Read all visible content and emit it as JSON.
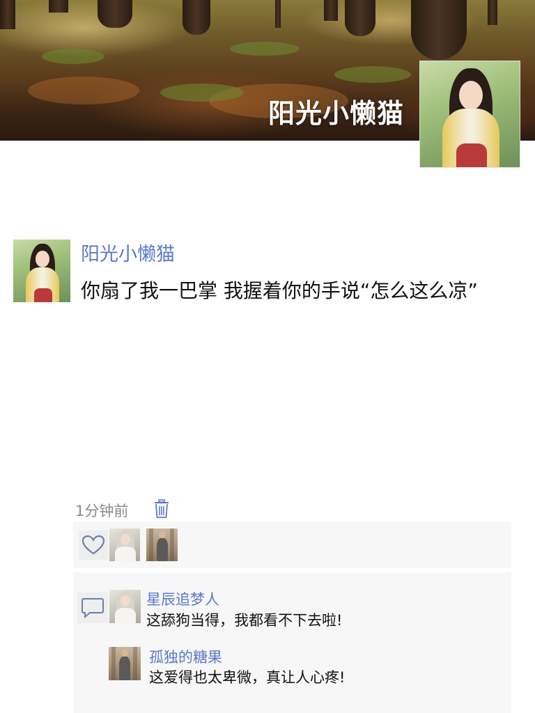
{
  "cover": {
    "title": "阳光小懒猫"
  },
  "post": {
    "author": "阳光小懒猫",
    "text": "你扇了我一巴掌 我握着你的手说“怎么这么凉”",
    "time": "1分钟前"
  },
  "likes": {
    "icon": "heart-icon"
  },
  "comments": [
    {
      "author": "星辰追梦人",
      "text": "这舔狗当得，我都看不下去啦!"
    },
    {
      "author": "孤独的糖果",
      "text": "这爱得也太卑微，真让人心疼!"
    }
  ],
  "colors": {
    "name_blue": "#5a79c9",
    "time_gray": "#8a8a8a",
    "panel_bg": "#f7f7f7"
  }
}
